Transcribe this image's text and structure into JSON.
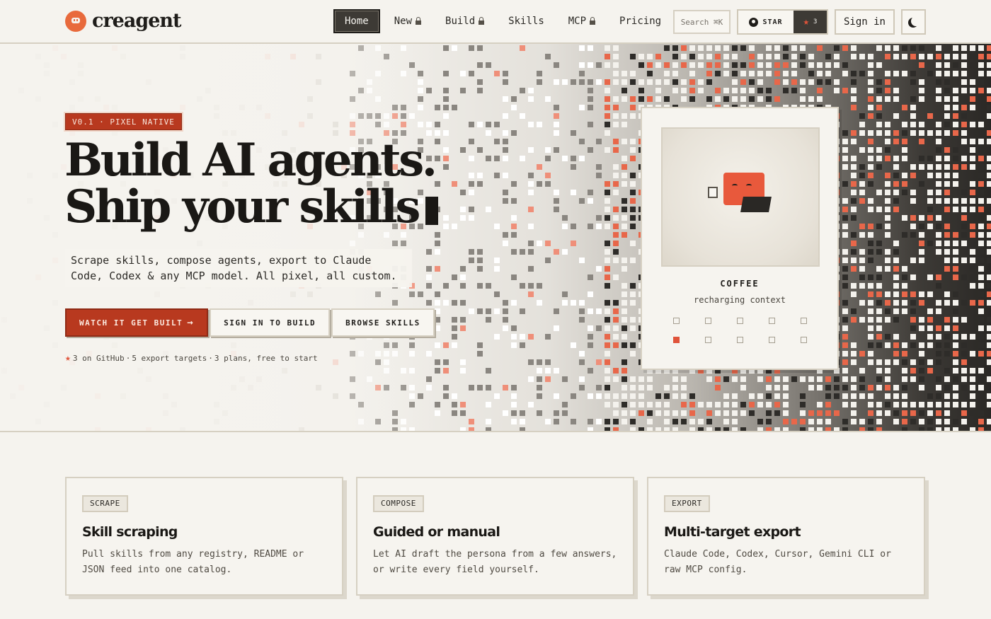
{
  "brand": {
    "name": "creagent"
  },
  "nav": {
    "items": [
      {
        "label": "Home",
        "locked": false,
        "active": true
      },
      {
        "label": "New",
        "locked": true,
        "active": false
      },
      {
        "label": "Build",
        "locked": true,
        "active": false
      },
      {
        "label": "Skills",
        "locked": false,
        "active": false
      },
      {
        "label": "MCP",
        "locked": true,
        "active": false
      },
      {
        "label": "Pricing",
        "locked": false,
        "active": false
      }
    ],
    "search_placeholder": "Search ⌘K",
    "github_label": "STAR",
    "github_count": "3",
    "signin_label": "Sign in"
  },
  "hero": {
    "badge": "V0.1 · PIXEL NATIVE",
    "title_line1": "Build AI agents.",
    "title_line2": "Ship your skills",
    "subtitle": "Scrape skills, compose agents, export to Claude Code, Codex & any MCP model. All pixel, all custom.",
    "cta_primary": "WATCH IT GET BUILT",
    "cta_secondary": "SIGN IN TO BUILD",
    "cta_tertiary": "BROWSE SKILLS",
    "meta": {
      "github": "3 on GitHub",
      "exports": "5 export targets",
      "plans": "3 plans, free to start"
    }
  },
  "mascot": {
    "name": "COFFEE",
    "status": "recharging context",
    "slots": [
      false,
      false,
      false,
      false,
      false,
      true,
      false,
      false,
      false,
      false
    ]
  },
  "features": [
    {
      "tag": "SCRAPE",
      "title": "Skill scraping",
      "desc": "Pull skills from any registry, README or JSON feed into one catalog."
    },
    {
      "tag": "COMPOSE",
      "title": "Guided or manual",
      "desc": "Let AI draft the persona from a few answers, or write every field yourself."
    },
    {
      "tag": "EXPORT",
      "title": "Multi-target export",
      "desc": "Claude Code, Codex, Cursor, Gemini CLI or raw MCP config."
    }
  ],
  "colors": {
    "accent": "#b8391f",
    "accent_light": "#e0533a",
    "background": "#f5f3ee",
    "ink": "#1f1d1a"
  }
}
